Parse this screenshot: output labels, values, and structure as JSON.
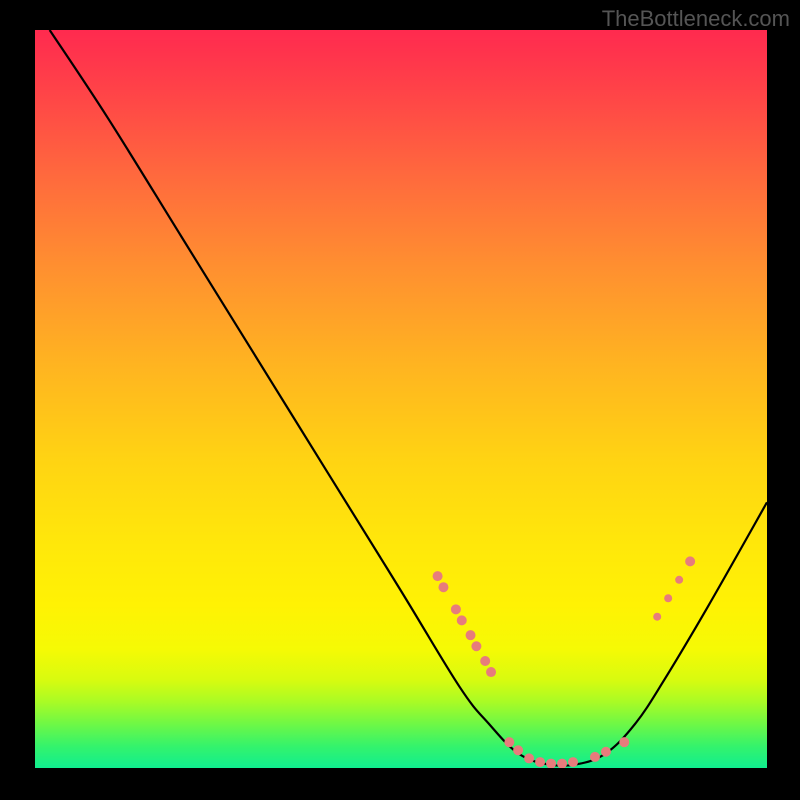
{
  "watermark": "TheBottleneck.com",
  "chart_data": {
    "type": "line",
    "title": "",
    "xlabel": "",
    "ylabel": "",
    "xlim": [
      0,
      100
    ],
    "ylim": [
      0,
      100
    ],
    "curve": [
      {
        "x": 2,
        "y": 100
      },
      {
        "x": 10,
        "y": 88
      },
      {
        "x": 20,
        "y": 72
      },
      {
        "x": 30,
        "y": 56
      },
      {
        "x": 40,
        "y": 40
      },
      {
        "x": 50,
        "y": 24
      },
      {
        "x": 58,
        "y": 11
      },
      {
        "x": 62,
        "y": 6
      },
      {
        "x": 66,
        "y": 2
      },
      {
        "x": 70,
        "y": 0.5
      },
      {
        "x": 74,
        "y": 0.5
      },
      {
        "x": 78,
        "y": 2
      },
      {
        "x": 82,
        "y": 6
      },
      {
        "x": 86,
        "y": 12
      },
      {
        "x": 92,
        "y": 22
      },
      {
        "x": 100,
        "y": 36
      }
    ],
    "markers": [
      {
        "x": 55.0,
        "y": 26.0,
        "r": 5
      },
      {
        "x": 55.8,
        "y": 24.5,
        "r": 5
      },
      {
        "x": 57.5,
        "y": 21.5,
        "r": 5
      },
      {
        "x": 58.3,
        "y": 20.0,
        "r": 5
      },
      {
        "x": 59.5,
        "y": 18.0,
        "r": 5
      },
      {
        "x": 60.3,
        "y": 16.5,
        "r": 5
      },
      {
        "x": 61.5,
        "y": 14.5,
        "r": 5
      },
      {
        "x": 62.3,
        "y": 13.0,
        "r": 5
      },
      {
        "x": 64.8,
        "y": 3.5,
        "r": 5
      },
      {
        "x": 66.0,
        "y": 2.4,
        "r": 5
      },
      {
        "x": 67.5,
        "y": 1.3,
        "r": 5
      },
      {
        "x": 69.0,
        "y": 0.8,
        "r": 5
      },
      {
        "x": 70.5,
        "y": 0.6,
        "r": 5
      },
      {
        "x": 72.0,
        "y": 0.6,
        "r": 5
      },
      {
        "x": 73.5,
        "y": 0.8,
        "r": 5
      },
      {
        "x": 76.5,
        "y": 1.5,
        "r": 5
      },
      {
        "x": 78.0,
        "y": 2.2,
        "r": 5
      },
      {
        "x": 80.5,
        "y": 3.5,
        "r": 5
      },
      {
        "x": 85.0,
        "y": 20.5,
        "r": 4
      },
      {
        "x": 86.5,
        "y": 23.0,
        "r": 4
      },
      {
        "x": 88.0,
        "y": 25.5,
        "r": 4
      },
      {
        "x": 89.5,
        "y": 28.0,
        "r": 5
      }
    ],
    "marker_color": "#e77c7c",
    "curve_color": "#000000"
  }
}
